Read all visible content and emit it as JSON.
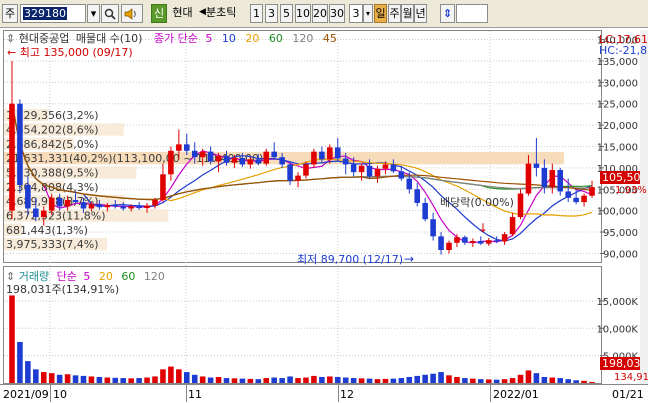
{
  "toolbar": {
    "market": "주",
    "code": "329180",
    "name_badge": "신",
    "name": "현대",
    "period_sep": "◀",
    "period_label": "분초틱",
    "minute_options": [
      "1",
      "3",
      "5",
      "10",
      "20",
      "30"
    ],
    "interval_value": "3",
    "day": "일",
    "week": "주",
    "month": "월",
    "year": "년"
  },
  "price_panel": {
    "title_stock": "현대중공업",
    "title_type": "매물대 수(10)",
    "ma_label": "종가 단순",
    "ma_periods": [
      {
        "label": "5",
        "color": "#c800c8"
      },
      {
        "label": "10",
        "color": "#1e3cd2"
      },
      {
        "label": "20",
        "color": "#e6a000"
      },
      {
        "label": "60",
        "color": "#1e8c1e"
      },
      {
        "label": "120",
        "color": "#808080"
      },
      {
        "label": "45",
        "color": "#a05000"
      }
    ],
    "high_marker": "최고 135,000 (09/17)",
    "low_marker": "최저 89,700 (12/17)",
    "dividend_label": "배당락(0.00%)",
    "lc_label": "LC:17,61",
    "hc_label": "HC:-21,8",
    "current_price": "105,50",
    "current_change": "1.93%",
    "volume_profile": [
      {
        "text": "1,729,356(3,2%)"
      },
      {
        "text": "4,654,202(8,6%)"
      },
      {
        "text": "2,686,842(5,0%)"
      },
      {
        "text": "21,631,331(40,2%)(113,100,00 ~ 110,400,00)"
      },
      {
        "text": "5,130,388(9,5%)"
      },
      {
        "text": "2,304,808(4,3%)"
      },
      {
        "text": "4,689,918(8,7%)"
      },
      {
        "text": "6,372,523(11,8%)"
      },
      {
        "text": "681,443(1,3%)"
      },
      {
        "text": "3,975,333(7,4%)"
      }
    ],
    "axis_labels": [
      "140,000",
      "135,000",
      "130,000",
      "125,000",
      "120,000",
      "115,000",
      "110,000",
      "105,000",
      "100,000",
      "95,000",
      "90,000"
    ]
  },
  "volume_panel": {
    "title": "거래량",
    "ma_label": "단순",
    "ma_periods": [
      {
        "label": "5",
        "color": "#c800c8"
      },
      {
        "label": "20",
        "color": "#e6a000"
      },
      {
        "label": "60",
        "color": "#1e8c1e"
      },
      {
        "label": "120",
        "color": "#808080"
      }
    ],
    "last_value": "198,031주(134,91%)",
    "axis_labels": [
      "15,000K",
      "10,000K",
      "5,000K"
    ],
    "current_volume": "198,03",
    "current_ratio": "134,91"
  },
  "date_axis": {
    "labels": [
      "2021/09",
      "10",
      "11",
      "12",
      "2022/01"
    ],
    "last_date": "01/21"
  },
  "chart_data": {
    "type": "candlestick",
    "title": "현대중공업",
    "candles": [
      {
        "o": 100000,
        "h": 135000,
        "l": 98000,
        "c": 125000
      },
      {
        "o": 125000,
        "h": 126000,
        "l": 104000,
        "c": 106000
      },
      {
        "o": 106000,
        "h": 108000,
        "l": 99000,
        "c": 100500
      },
      {
        "o": 100500,
        "h": 103000,
        "l": 97500,
        "c": 98500
      },
      {
        "o": 98500,
        "h": 101000,
        "l": 96500,
        "c": 100000
      },
      {
        "o": 100000,
        "h": 104000,
        "l": 99000,
        "c": 103000
      },
      {
        "o": 103000,
        "h": 104000,
        "l": 100000,
        "c": 101000
      },
      {
        "o": 101000,
        "h": 103500,
        "l": 100000,
        "c": 102500
      },
      {
        "o": 102500,
        "h": 104500,
        "l": 101500,
        "c": 102000
      },
      {
        "o": 102000,
        "h": 103000,
        "l": 99500,
        "c": 100500
      },
      {
        "o": 100500,
        "h": 102000,
        "l": 99800,
        "c": 101500
      },
      {
        "o": 101500,
        "h": 102500,
        "l": 100200,
        "c": 100800
      },
      {
        "o": 100800,
        "h": 101800,
        "l": 99800,
        "c": 101300
      },
      {
        "o": 101300,
        "h": 102500,
        "l": 100500,
        "c": 101000
      },
      {
        "o": 101000,
        "h": 102000,
        "l": 100000,
        "c": 100500
      },
      {
        "o": 100500,
        "h": 101500,
        "l": 99800,
        "c": 101000
      },
      {
        "o": 101000,
        "h": 102000,
        "l": 100200,
        "c": 100600
      },
      {
        "o": 100600,
        "h": 101800,
        "l": 99500,
        "c": 101200
      },
      {
        "o": 101200,
        "h": 103000,
        "l": 100500,
        "c": 102500
      },
      {
        "o": 102500,
        "h": 111000,
        "l": 102000,
        "c": 108500
      },
      {
        "o": 108500,
        "h": 115000,
        "l": 107000,
        "c": 114000
      },
      {
        "o": 114000,
        "h": 119000,
        "l": 112000,
        "c": 115500
      },
      {
        "o": 115500,
        "h": 118000,
        "l": 113000,
        "c": 114000
      },
      {
        "o": 114000,
        "h": 116000,
        "l": 111000,
        "c": 112500
      },
      {
        "o": 112500,
        "h": 114500,
        "l": 110500,
        "c": 113800
      },
      {
        "o": 113800,
        "h": 115000,
        "l": 110800,
        "c": 111500
      },
      {
        "o": 111500,
        "h": 113500,
        "l": 109000,
        "c": 112800
      },
      {
        "o": 112800,
        "h": 114000,
        "l": 110500,
        "c": 111200
      },
      {
        "o": 111200,
        "h": 113000,
        "l": 110000,
        "c": 112300
      },
      {
        "o": 112300,
        "h": 113500,
        "l": 110200,
        "c": 110800
      },
      {
        "o": 110800,
        "h": 112500,
        "l": 109800,
        "c": 112000
      },
      {
        "o": 112000,
        "h": 113200,
        "l": 110600,
        "c": 111000
      },
      {
        "o": 111000,
        "h": 114500,
        "l": 110500,
        "c": 113800
      },
      {
        "o": 113800,
        "h": 116000,
        "l": 112000,
        "c": 112500
      },
      {
        "o": 112500,
        "h": 113500,
        "l": 110000,
        "c": 110800
      },
      {
        "o": 110800,
        "h": 111500,
        "l": 106000,
        "c": 107000
      },
      {
        "o": 107000,
        "h": 109000,
        "l": 105500,
        "c": 108200
      },
      {
        "o": 108200,
        "h": 111500,
        "l": 107500,
        "c": 110800
      },
      {
        "o": 110800,
        "h": 114500,
        "l": 110000,
        "c": 113800
      },
      {
        "o": 113800,
        "h": 115000,
        "l": 111000,
        "c": 112000
      },
      {
        "o": 112000,
        "h": 115500,
        "l": 111000,
        "c": 114800
      },
      {
        "o": 114800,
        "h": 117000,
        "l": 111500,
        "c": 112200
      },
      {
        "o": 112200,
        "h": 113500,
        "l": 108500,
        "c": 110800
      },
      {
        "o": 110800,
        "h": 112500,
        "l": 108000,
        "c": 109000
      },
      {
        "o": 109000,
        "h": 111000,
        "l": 107000,
        "c": 110500
      },
      {
        "o": 110500,
        "h": 112000,
        "l": 107500,
        "c": 108000
      },
      {
        "o": 108000,
        "h": 110500,
        "l": 106500,
        "c": 109800
      },
      {
        "o": 109800,
        "h": 111500,
        "l": 108500,
        "c": 110800
      },
      {
        "o": 110800,
        "h": 112000,
        "l": 108800,
        "c": 109200
      },
      {
        "o": 109200,
        "h": 110500,
        "l": 107000,
        "c": 107500
      },
      {
        "o": 107500,
        "h": 109000,
        "l": 104000,
        "c": 105000
      },
      {
        "o": 105000,
        "h": 106500,
        "l": 101000,
        "c": 101800
      },
      {
        "o": 101800,
        "h": 103000,
        "l": 97500,
        "c": 98000
      },
      {
        "o": 98000,
        "h": 99500,
        "l": 93000,
        "c": 94000
      },
      {
        "o": 94000,
        "h": 95000,
        "l": 89700,
        "c": 90800
      },
      {
        "o": 90800,
        "h": 93000,
        "l": 90000,
        "c": 92500
      },
      {
        "o": 92500,
        "h": 94500,
        "l": 91500,
        "c": 93800
      },
      {
        "o": 93800,
        "h": 94200,
        "l": 92000,
        "c": 92500
      },
      {
        "o": 92500,
        "h": 93500,
        "l": 91500,
        "c": 92900
      },
      {
        "o": 92900,
        "h": 94000,
        "l": 92000,
        "c": 92300
      },
      {
        "o": 92300,
        "h": 93600,
        "l": 91800,
        "c": 93100
      },
      {
        "o": 93100,
        "h": 94000,
        "l": 92400,
        "c": 92800
      },
      {
        "o": 92800,
        "h": 95000,
        "l": 92000,
        "c": 94500
      },
      {
        "o": 94500,
        "h": 99500,
        "l": 94000,
        "c": 98500
      },
      {
        "o": 98500,
        "h": 105000,
        "l": 98000,
        "c": 104000
      },
      {
        "o": 104000,
        "h": 113000,
        "l": 103500,
        "c": 111000
      },
      {
        "o": 111000,
        "h": 117000,
        "l": 108000,
        "c": 110000
      },
      {
        "o": 110000,
        "h": 112000,
        "l": 104000,
        "c": 105500
      },
      {
        "o": 105500,
        "h": 111000,
        "l": 104000,
        "c": 109500
      },
      {
        "o": 109500,
        "h": 110000,
        "l": 103500,
        "c": 104500
      },
      {
        "o": 104500,
        "h": 107500,
        "l": 102000,
        "c": 103000
      },
      {
        "o": 103000,
        "h": 105000,
        "l": 101500,
        "c": 102000
      },
      {
        "o": 102000,
        "h": 104000,
        "l": 101000,
        "c": 103500
      },
      {
        "o": 103500,
        "h": 107000,
        "l": 103000,
        "c": 105500
      }
    ],
    "volume": [
      16000000,
      7500000,
      4000000,
      2500000,
      2000000,
      1800000,
      1500000,
      1600000,
      1400000,
      1300000,
      1200000,
      1100000,
      1000000,
      950000,
      900000,
      850000,
      900000,
      1000000,
      1200000,
      2500000,
      3000000,
      2500000,
      2000000,
      1500000,
      1200000,
      1000000,
      1100000,
      900000,
      850000,
      800000,
      750000,
      700000,
      900000,
      1000000,
      900000,
      1200000,
      900000,
      1000000,
      1300000,
      1100000,
      1200000,
      1100000,
      1000000,
      900000,
      850000,
      800000,
      700000,
      750000,
      800000,
      900000,
      1100000,
      1300000,
      1500000,
      1700000,
      2000000,
      1400000,
      1100000,
      900000,
      800000,
      700000,
      650000,
      600000,
      700000,
      900000,
      1500000,
      2300000,
      1800000,
      1100000,
      1000000,
      900000,
      700000,
      500000,
      400000,
      198031
    ],
    "ylim": [
      88000,
      142000
    ]
  }
}
